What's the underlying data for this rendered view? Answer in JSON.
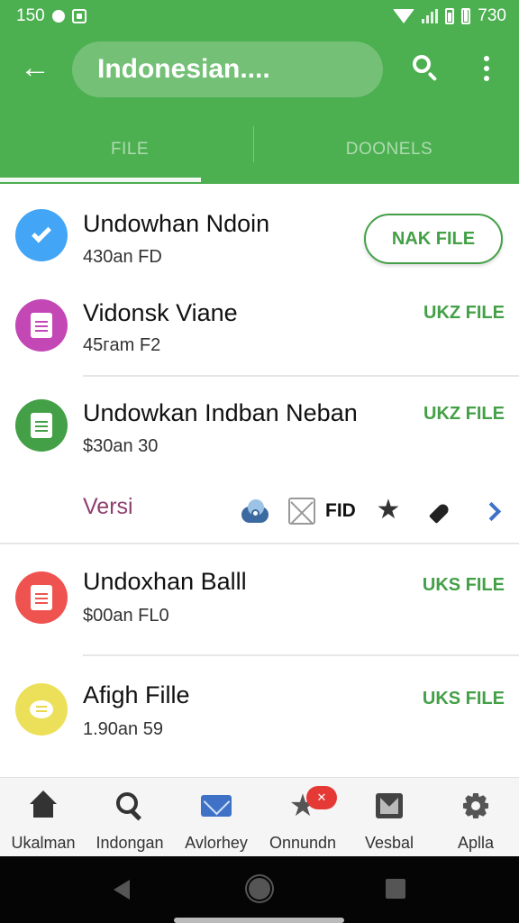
{
  "status_bar": {
    "time": "150",
    "right_time": "730"
  },
  "app_bar": {
    "search_text": "Indonesian....",
    "tabs": [
      {
        "label": "FILE",
        "active": true
      },
      {
        "label": "DOONELS",
        "active": false
      }
    ]
  },
  "colors": {
    "primary": "#4caf50",
    "accent": "#43a047",
    "versi": "#8e3f6f"
  },
  "items": [
    {
      "title": "Undowhan Ndoin",
      "subtitle": "430an FD",
      "action": "NAK FILE",
      "icon": "check-icon",
      "color": "#42a5f5"
    },
    {
      "title": "Vidonsk Viane",
      "subtitle": "45гam F2",
      "action": "UKZ FILE",
      "icon": "document-icon",
      "color": "#c447b6"
    },
    {
      "title": "Undowkan Indban Neban",
      "subtitle": "$30an 30",
      "action": "UKZ FILE",
      "icon": "document-icon",
      "color": "#43a047"
    },
    {
      "title": "Undoxhan Balll",
      "subtitle": "$00an FL0",
      "action": "UKS FILE",
      "icon": "document-icon",
      "color": "#ef5350"
    },
    {
      "title": "Afigh Fille",
      "subtitle": "1.90an 59",
      "action": "UKS FILE",
      "icon": "chat-icon",
      "color": "#ece05a"
    }
  ],
  "toolbar": {
    "versi_label": "Versi",
    "fid_label": "FID"
  },
  "bottom_nav": [
    {
      "label": "Ukalman",
      "icon": "home-icon"
    },
    {
      "label": "Indongan",
      "icon": "search-icon"
    },
    {
      "label": "Avlorhey",
      "icon": "mail-icon"
    },
    {
      "label": "Onnundn",
      "icon": "star-icon",
      "badge": "✕"
    },
    {
      "label": "Vesbal",
      "icon": "image-icon"
    },
    {
      "label": "Aplla",
      "icon": "settings-icon"
    }
  ]
}
